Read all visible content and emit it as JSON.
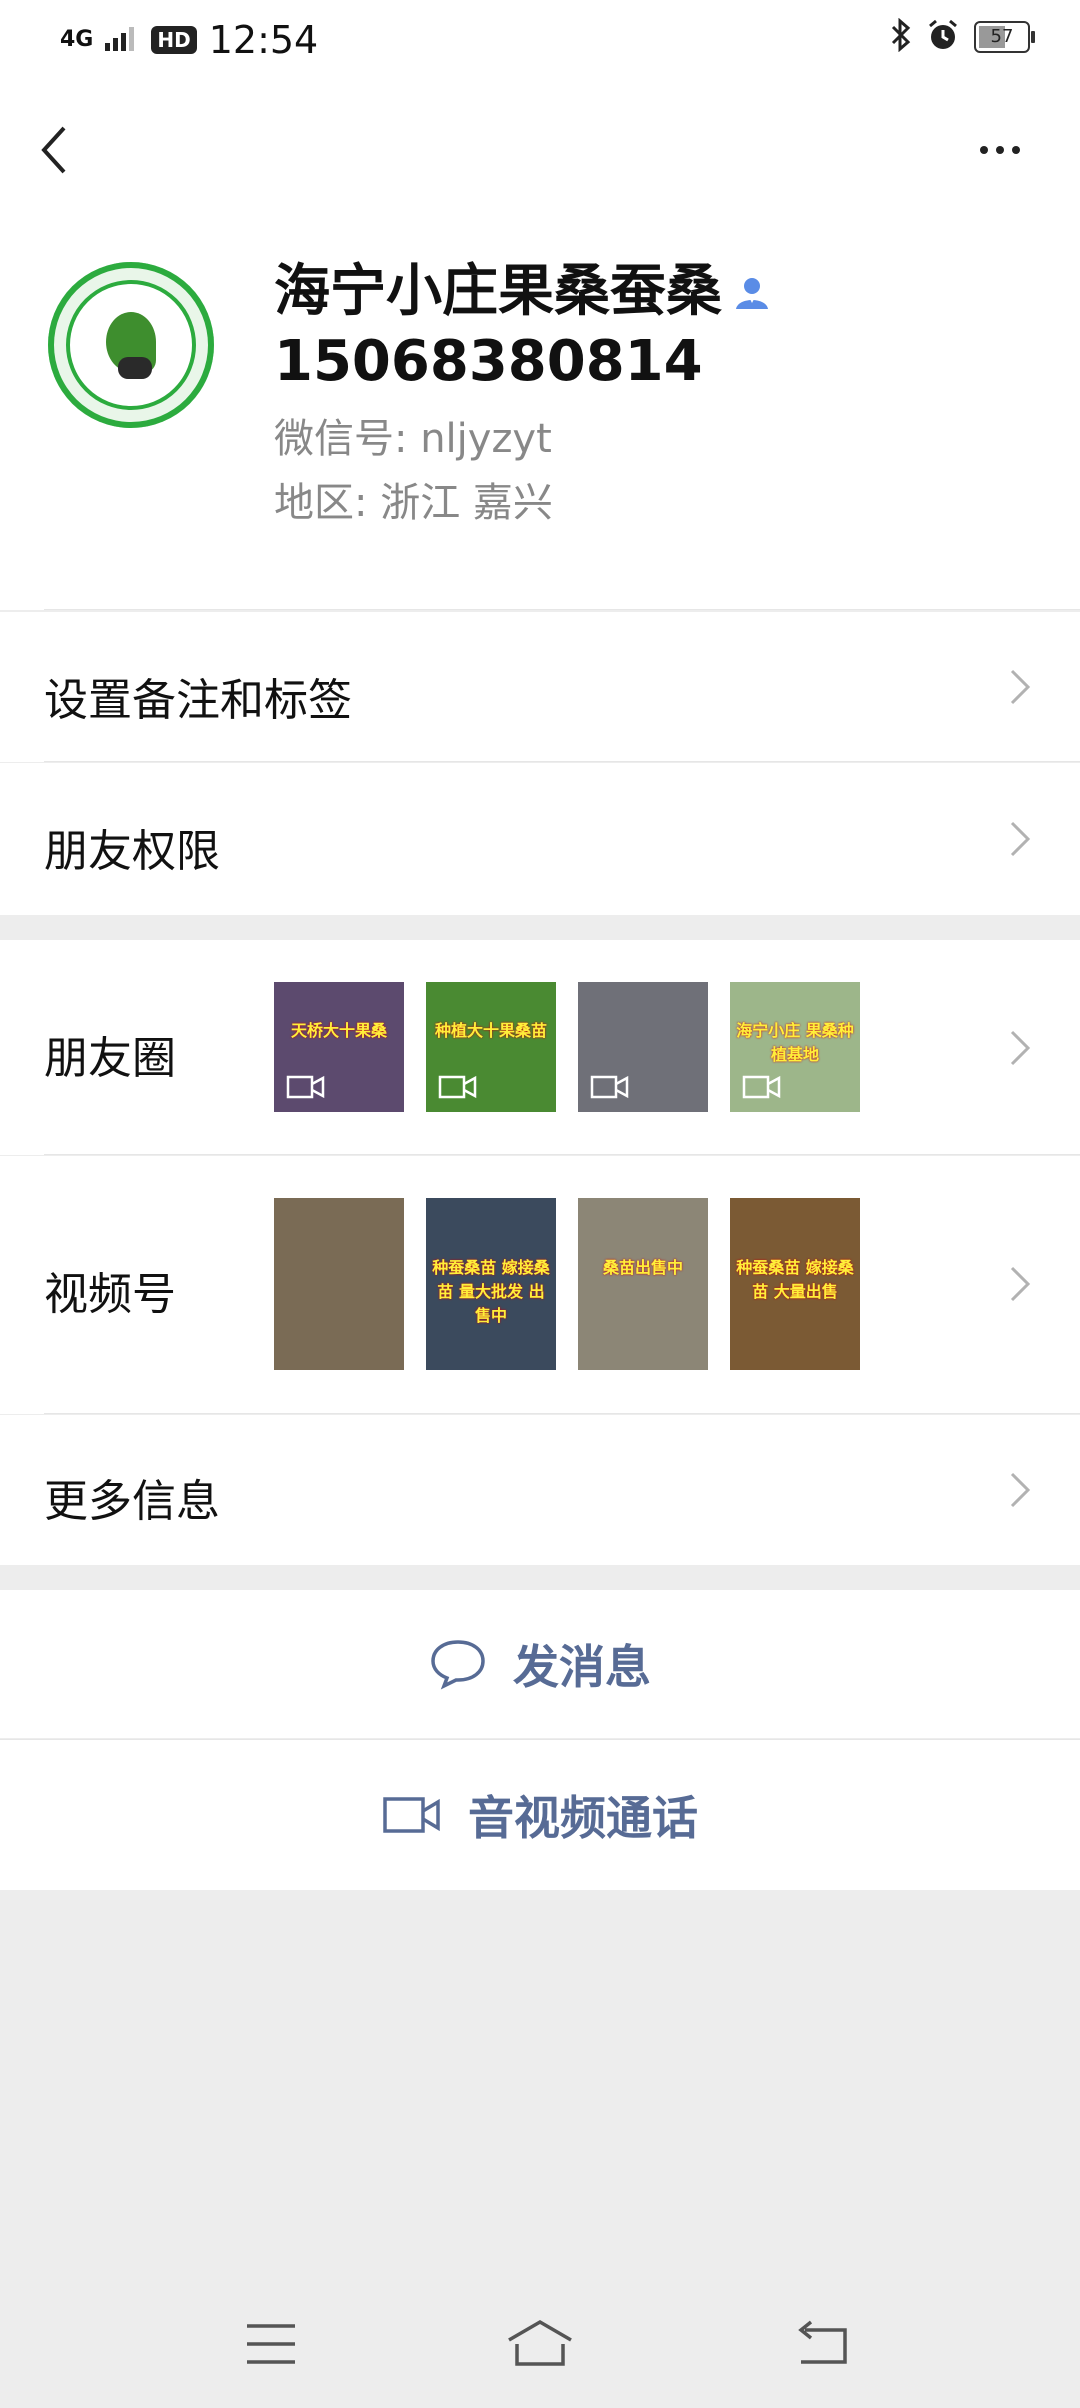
{
  "status_bar": {
    "network": "4G",
    "hd": "HD",
    "time": "12:54",
    "battery_level": "57",
    "battery_fraction": 0.57
  },
  "profile": {
    "name": "海宁小庄果桑蚕桑",
    "phone": "15068380814",
    "wechat_id": "微信号: nljyzyt",
    "region": "地区: 浙江  嘉兴"
  },
  "menu": {
    "remark_label": "设置备注和标签",
    "permission_label": "朋友权限",
    "moments_label": "朋友圈",
    "channels_label": "视频号",
    "more_info_label": "更多信息"
  },
  "moments_thumbs": [
    {
      "caption": "天桥大十果桑",
      "bg": "#5c4a6e"
    },
    {
      "caption": "种植大十果桑苗",
      "bg": "#4a8a32"
    },
    {
      "caption": "",
      "bg": "#6f7078"
    },
    {
      "caption": "海宁小庄 果桑种植基地",
      "bg": "#9db68a"
    }
  ],
  "channel_thumbs": [
    {
      "caption": "",
      "bg": "#7a6b55"
    },
    {
      "caption": "种蚕桑苗 嫁接桑苗 量大批发 出售中",
      "bg": "#3b4a5d"
    },
    {
      "caption": "桑苗出售中",
      "bg": "#8c8676"
    },
    {
      "caption": "种蚕桑苗 嫁接桑苗 大量出售",
      "bg": "#7b5a34"
    }
  ],
  "actions": {
    "send_message": "发消息",
    "av_call": "音视频通话"
  },
  "colors": {
    "link_blue": "#576b95",
    "background": "#ededed",
    "verified_blue": "#5a8ce6"
  }
}
